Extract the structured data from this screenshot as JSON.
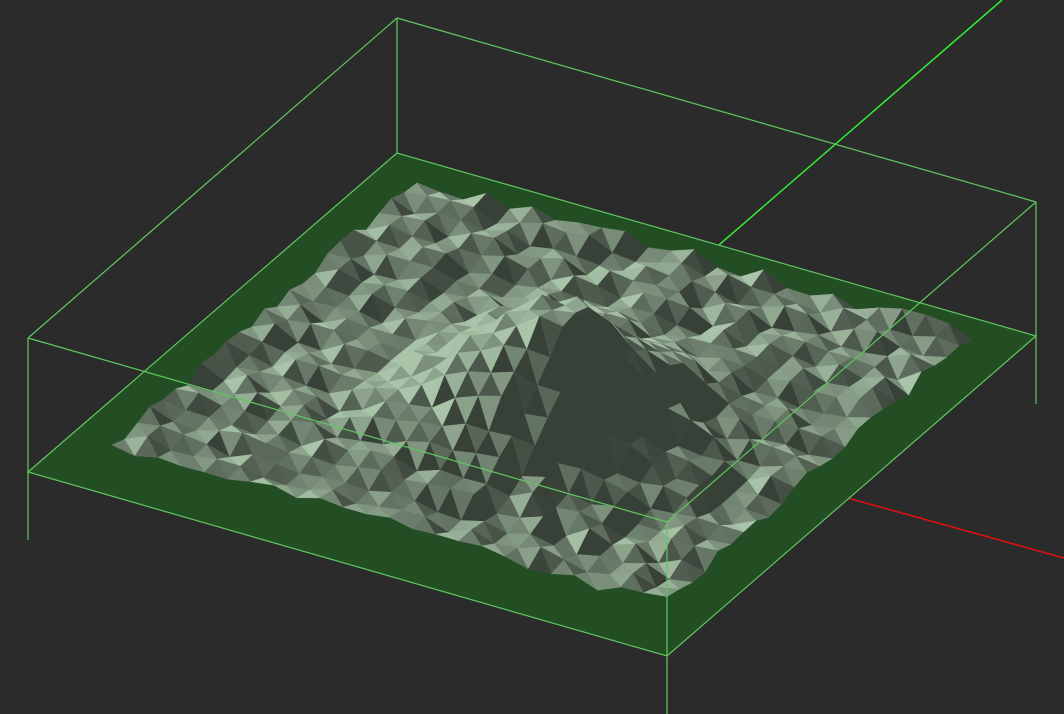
{
  "scene": {
    "background_color": "#2b2b2b",
    "bounding_box_color": "#5fc85f",
    "base_plate_color": "#234d23",
    "terrain_color": "#7d917d",
    "axes": {
      "x_color": "#e01010",
      "y_color": "#33ee33"
    },
    "terrain": {
      "peak_height_fraction": 0.55,
      "noise_amplitude_fraction": 0.08
    }
  }
}
